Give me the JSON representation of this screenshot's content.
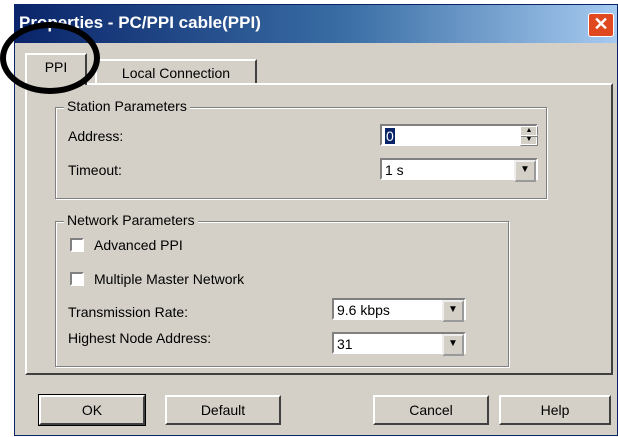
{
  "window": {
    "title": "Properties - PC/PPI cable(PPI)"
  },
  "tabs": [
    {
      "label": "PPI"
    },
    {
      "label": "Local Connection"
    }
  ],
  "station": {
    "legend": "Station Parameters",
    "address_label": "Address:",
    "address_value": "0",
    "timeout_label": "Timeout:",
    "timeout_value": "1 s"
  },
  "network": {
    "legend": "Network Parameters",
    "advanced_ppi_label": "Advanced PPI",
    "advanced_ppi_checked": false,
    "multi_master_label": "Multiple Master Network",
    "multi_master_checked": false,
    "rate_label": "Transmission Rate:",
    "rate_value": "9.6 kbps",
    "highest_label": "Highest Node Address:",
    "highest_value": "31"
  },
  "buttons": {
    "ok": "OK",
    "default": "Default",
    "cancel": "Cancel",
    "help": "Help"
  }
}
